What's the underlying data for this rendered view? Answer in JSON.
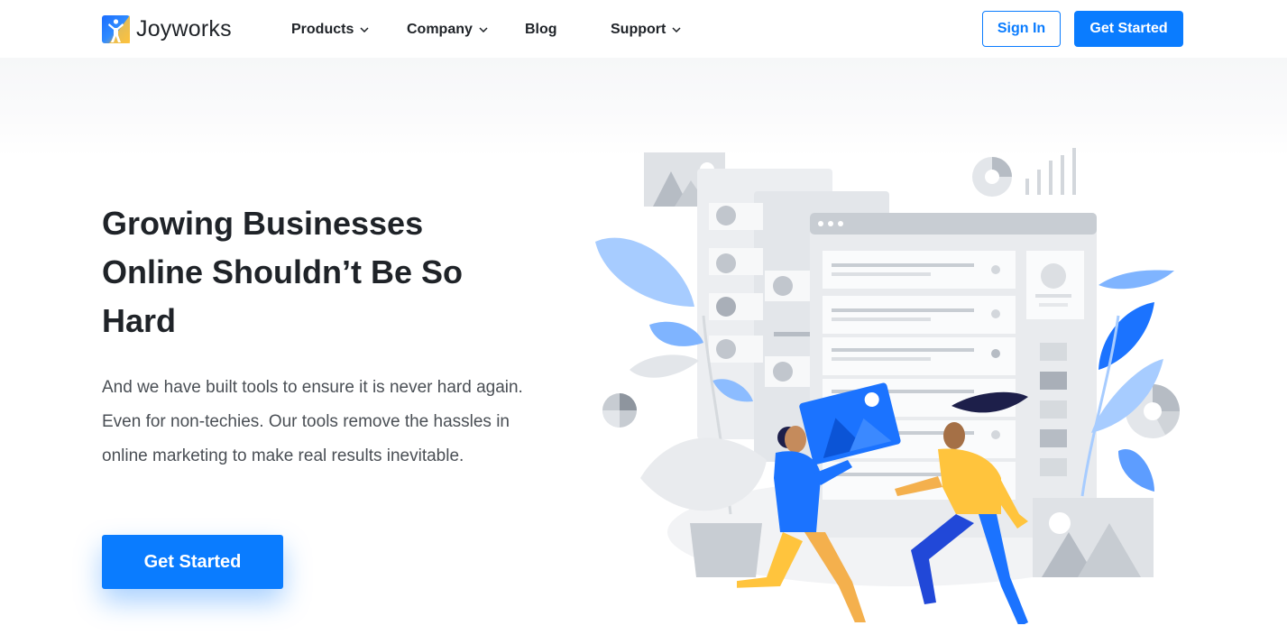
{
  "brand": {
    "name": "Joyworks",
    "logo_icon": "joyworks-logo-icon",
    "accent_color": "#0a7cff"
  },
  "nav": {
    "items": [
      {
        "label": "Products",
        "has_dropdown": true,
        "icon": "chevron-down-icon"
      },
      {
        "label": "Company",
        "has_dropdown": true,
        "icon": "chevron-down-icon"
      },
      {
        "label": "Blog",
        "has_dropdown": false
      },
      {
        "label": "Support",
        "has_dropdown": true,
        "icon": "chevron-down-icon"
      }
    ],
    "sign_in_label": "Sign In",
    "get_started_label": "Get Started"
  },
  "hero": {
    "title": "Growing Businesses Online Shouldn’t Be So Hard",
    "subtitle": "And we have built tools to ensure it is never hard again. Even for non-techies. Our tools remove the hassles in online marketing to make real results inevitable.",
    "cta_label": "Get Started"
  }
}
